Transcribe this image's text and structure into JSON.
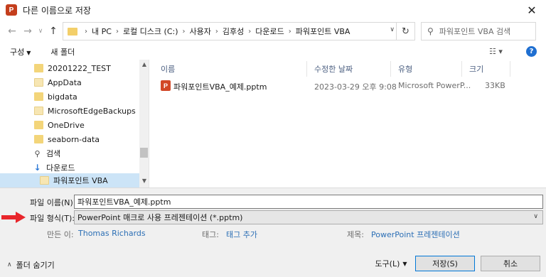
{
  "window": {
    "title": "다른 이름으로 저장",
    "app_icon_letter": "P"
  },
  "address": {
    "crumbs": [
      "내 PC",
      "로컬 디스크 (C:)",
      "사용자",
      "김후성",
      "다운로드",
      "파워포인트 VBA"
    ],
    "search_placeholder": "파워포인트 VBA 검색"
  },
  "toolbar": {
    "organize": "구성",
    "new_folder": "새 폴더"
  },
  "nav": {
    "items": [
      {
        "label": "20201222_TEST",
        "icon": "folder-icon"
      },
      {
        "label": "AppData",
        "icon": "folder-icon"
      },
      {
        "label": "bigdata",
        "icon": "folder-icon"
      },
      {
        "label": "MicrosoftEdgeBackups",
        "icon": "folder-icon"
      },
      {
        "label": "OneDrive",
        "icon": "folder-icon"
      },
      {
        "label": "seaborn-data",
        "icon": "folder-icon"
      },
      {
        "label": "검색",
        "icon": "search-icon"
      },
      {
        "label": "다운로드",
        "icon": "download-icon"
      },
      {
        "label": "파워포인트 VBA",
        "icon": "folder-icon",
        "selected": true
      }
    ]
  },
  "files": {
    "columns": [
      "이름",
      "수정한 날짜",
      "유형",
      "크기"
    ],
    "rows": [
      {
        "name": "파워포인트VBA_예제.pptm",
        "modified": "2023-03-29 오후 9:08",
        "type": "Microsoft PowerP...",
        "size": "33KB"
      }
    ]
  },
  "form": {
    "filename_label": "파일 이름(N):",
    "filename_value": "파워포인트VBA_예제.pptm",
    "filetype_label": "파일 형식(T):",
    "filetype_value": "PowerPoint 매크로 사용 프레젠테이션 (*.pptm)",
    "author_label": "만든 이:",
    "author_value": "Thomas Richards",
    "tags_label": "태그:",
    "tags_value": "태그 추가",
    "title_label": "제목:",
    "title_value": "PowerPoint 프레젠테이션",
    "hide_folders": "폴더 숨기기",
    "tools": "도구(L)",
    "save": "저장(S)",
    "cancel": "취소"
  },
  "colors": {
    "accent": "#0078d7",
    "selection": "#cce4f7",
    "link": "#2c6fb5",
    "annotation_arrow": "#e8262b"
  }
}
